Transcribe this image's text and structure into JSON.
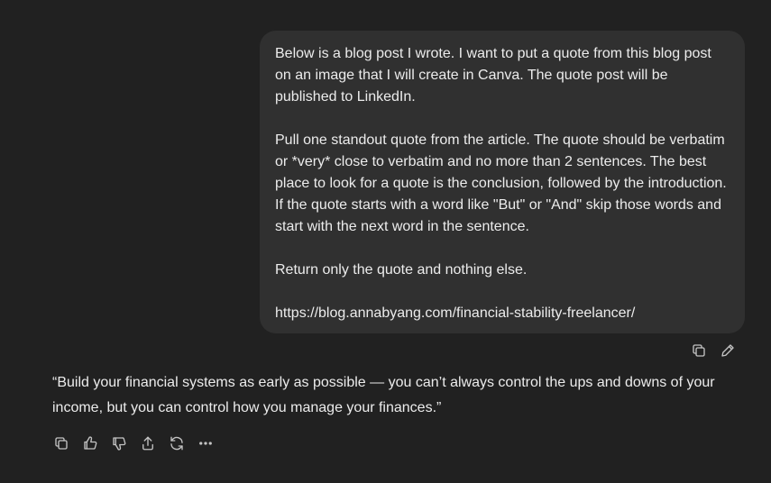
{
  "conversation": {
    "user_message": {
      "paragraph_1": "Below is a blog post I wrote. I want to put a quote from this blog post on an image that I will create in Canva. The quote post will be published to LinkedIn.",
      "paragraph_2": "Pull one standout quote from the article. The quote should be verbatim or *very* close to verbatim and no more than 2 sentences. The best place to look for a quote is the conclusion, followed by the introduction. If the quote starts with a word like \"But\" or \"And\" skip those words and start with the next word in the sentence.",
      "paragraph_3": "Return only the quote and nothing else.",
      "paragraph_4": "https://blog.annabyang.com/financial-stability-freelancer/"
    },
    "user_actions": [
      "copy-icon",
      "edit-icon"
    ],
    "assistant_message": {
      "text": "“Build your financial systems as early as possible — you can’t always control the ups and downs of your income, but you can control how you manage your finances.”"
    },
    "assistant_actions": [
      "copy-icon",
      "thumbs-up-icon",
      "thumbs-down-icon",
      "share-icon",
      "regenerate-icon",
      "more-icon"
    ]
  },
  "colors": {
    "background": "#212121",
    "bubble": "#303030",
    "text": "#ececec",
    "icon": "#c4c4c4"
  }
}
